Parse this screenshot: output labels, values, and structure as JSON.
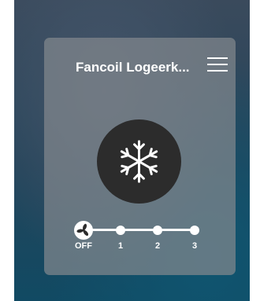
{
  "card": {
    "title": "Fancoil Logeerk..."
  },
  "icons": {
    "menu": "hamburger-menu-icon",
    "mode": "snowflake-icon",
    "off": "fan-icon"
  },
  "fan_speed": {
    "levels": [
      {
        "label": "OFF"
      },
      {
        "label": "1"
      },
      {
        "label": "2"
      },
      {
        "label": "3"
      }
    ],
    "selected": "OFF"
  },
  "colors": {
    "card_background": "#82888e",
    "button_background": "#2c2c2c",
    "foreground": "#ffffff"
  }
}
